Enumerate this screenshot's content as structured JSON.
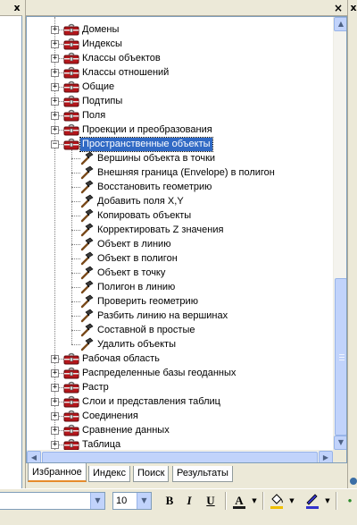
{
  "window": {
    "left_close_glyph": "x",
    "close_glyph": "×",
    "right_close_glyph": "x"
  },
  "tree": {
    "items": [
      {
        "label": "Домены",
        "kind": "toolbox",
        "level": 0,
        "expanded": false
      },
      {
        "label": "Индексы",
        "kind": "toolbox",
        "level": 0,
        "expanded": false
      },
      {
        "label": "Классы объектов",
        "kind": "toolbox",
        "level": 0,
        "expanded": false
      },
      {
        "label": "Классы отношений",
        "kind": "toolbox",
        "level": 0,
        "expanded": false
      },
      {
        "label": "Общие",
        "kind": "toolbox",
        "level": 0,
        "expanded": false
      },
      {
        "label": "Подтипы",
        "kind": "toolbox",
        "level": 0,
        "expanded": false
      },
      {
        "label": "Поля",
        "kind": "toolbox",
        "level": 0,
        "expanded": false
      },
      {
        "label": "Проекции и преобразования",
        "kind": "toolbox",
        "level": 0,
        "expanded": false
      },
      {
        "label": "Пространственные объекты",
        "kind": "toolbox",
        "level": 0,
        "expanded": true,
        "selected": true
      },
      {
        "label": "Вершины объекта в точки",
        "kind": "tool",
        "level": 1
      },
      {
        "label": "Внешняя граница (Envelope) в полигон",
        "kind": "tool",
        "level": 1
      },
      {
        "label": "Восстановить геометрию",
        "kind": "tool",
        "level": 1
      },
      {
        "label": "Добавить поля  X,Y",
        "kind": "tool",
        "level": 1
      },
      {
        "label": "Копировать объекты",
        "kind": "tool",
        "level": 1
      },
      {
        "label": "Корректировать Z значения",
        "kind": "tool",
        "level": 1
      },
      {
        "label": "Объект в линию",
        "kind": "tool",
        "level": 1
      },
      {
        "label": "Объект в полигон",
        "kind": "tool",
        "level": 1
      },
      {
        "label": "Объект в точку",
        "kind": "tool",
        "level": 1
      },
      {
        "label": "Полигон в линию",
        "kind": "tool",
        "level": 1
      },
      {
        "label": "Проверить геометрию",
        "kind": "tool",
        "level": 1
      },
      {
        "label": "Разбить линию на вершинах",
        "kind": "tool",
        "level": 1
      },
      {
        "label": "Составной в простые",
        "kind": "tool",
        "level": 1
      },
      {
        "label": "Удалить объекты",
        "kind": "tool",
        "level": 1
      },
      {
        "label": "Рабочая область",
        "kind": "toolbox",
        "level": 0,
        "expanded": false
      },
      {
        "label": "Распределенные базы геоданных",
        "kind": "toolbox",
        "level": 0,
        "expanded": false
      },
      {
        "label": "Растр",
        "kind": "toolbox",
        "level": 0,
        "expanded": false
      },
      {
        "label": "Слои и представления таблиц",
        "kind": "toolbox",
        "level": 0,
        "expanded": false
      },
      {
        "label": "Соединения",
        "kind": "toolbox",
        "level": 0,
        "expanded": false
      },
      {
        "label": "Сравнение данных",
        "kind": "toolbox",
        "level": 0,
        "expanded": false
      },
      {
        "label": "Таблица",
        "kind": "toolbox",
        "level": 0,
        "expanded": false
      }
    ],
    "expand_glyph": "+",
    "collapse_glyph": "−"
  },
  "scrollbars": {
    "up_glyph": "▲",
    "down_glyph": "▼",
    "left_glyph": "◀",
    "right_glyph": "▶"
  },
  "tabs": [
    {
      "label": "Избранное",
      "active": true
    },
    {
      "label": "Индекс",
      "active": false
    },
    {
      "label": "Поиск",
      "active": false
    },
    {
      "label": "Результаты",
      "active": false
    }
  ],
  "toolbar": {
    "font_size_value": "10",
    "bold_label": "B",
    "italic_label": "I",
    "underline_label": "U",
    "font_color_label": "A",
    "dropdown_glyph": "▼",
    "font_color": "#1c1c1c",
    "fill_color": "#f0c000",
    "line_color": "#3333cc"
  },
  "icons": {
    "toolbox": "red-toolbox-icon",
    "tool": "hammer-icon"
  },
  "colors": {
    "selection": "#316ac5",
    "toolbox_red": "#b5161b",
    "scroll": "#c1d3fb",
    "tab_highlight": "#e68b2c"
  }
}
